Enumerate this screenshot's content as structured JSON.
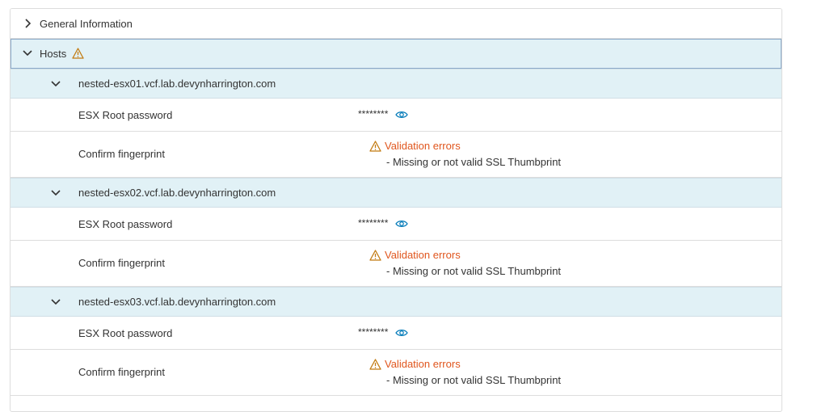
{
  "sections": {
    "general": {
      "label": "General Information",
      "expanded": false
    },
    "hosts": {
      "label": "Hosts",
      "expanded": true,
      "has_warning": true
    }
  },
  "hosts": [
    {
      "hostname": "nested-esx01.vcf.lab.devynharrington.com",
      "password_label": "ESX Root password",
      "password_mask": "********",
      "fingerprint_label": "Confirm fingerprint",
      "validation_title": "Validation errors",
      "validation_message": "- Missing or not valid SSL Thumbprint"
    },
    {
      "hostname": "nested-esx02.vcf.lab.devynharrington.com",
      "password_label": "ESX Root password",
      "password_mask": "********",
      "fingerprint_label": "Confirm fingerprint",
      "validation_title": "Validation errors",
      "validation_message": "- Missing or not valid SSL Thumbprint"
    },
    {
      "hostname": "nested-esx03.vcf.lab.devynharrington.com",
      "password_label": "ESX Root password",
      "password_mask": "********",
      "fingerprint_label": "Confirm fingerprint",
      "validation_title": "Validation errors",
      "validation_message": "- Missing or not valid SSL Thumbprint"
    }
  ],
  "colors": {
    "header_bg": "#e1f1f6",
    "error": "#e0561e",
    "warning_icon": "#c27b12",
    "eye_icon": "#0079b8"
  }
}
